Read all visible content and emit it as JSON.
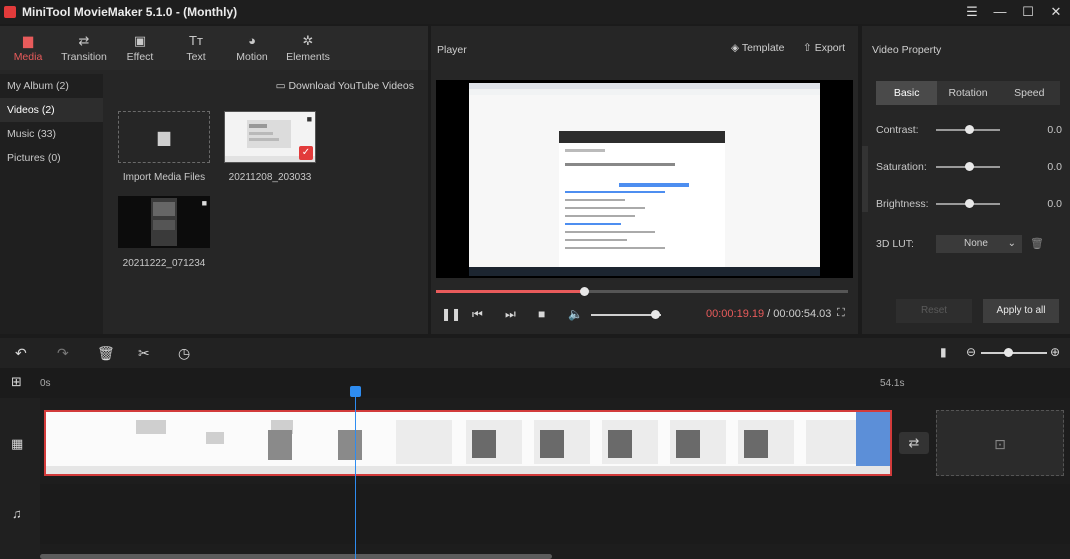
{
  "app": {
    "title": "MiniTool MovieMaker 5.1.0 - (Monthly)"
  },
  "window_controls": {
    "menu": "☰",
    "minimize": "—",
    "maximize": "☐",
    "close": "✕"
  },
  "toolbar": {
    "items": [
      {
        "label": "Media",
        "icon": "folder-icon",
        "glyph": "▆"
      },
      {
        "label": "Transition",
        "icon": "swap-icon",
        "glyph": "⇄"
      },
      {
        "label": "Effect",
        "icon": "effect-icon",
        "glyph": "▣"
      },
      {
        "label": "Text",
        "icon": "text-icon",
        "glyph": "Tт"
      },
      {
        "label": "Motion",
        "icon": "motion-icon",
        "glyph": "◕"
      },
      {
        "label": "Elements",
        "icon": "elements-icon",
        "glyph": "✲"
      }
    ]
  },
  "sidebar": {
    "items": [
      {
        "label": "My Album  (2)"
      },
      {
        "label": "Videos (2)"
      },
      {
        "label": "Music (33)"
      },
      {
        "label": "Pictures (0)"
      }
    ]
  },
  "media": {
    "download_label": "Download YouTube Videos",
    "import_label": "Import Media Files",
    "files": [
      {
        "name": "20211208_203033"
      },
      {
        "name": "20211222_071234"
      }
    ]
  },
  "player": {
    "label": "Player",
    "template_label": "Template",
    "export_label": "Export",
    "current_time": "00:00:19.19",
    "separator": " / ",
    "total_time": "00:00:54.03",
    "progress": 0.36,
    "volume": 0.92
  },
  "properties": {
    "title": "Video Property",
    "tabs": [
      {
        "label": "Basic"
      },
      {
        "label": "Rotation"
      },
      {
        "label": "Speed"
      }
    ],
    "rows": [
      {
        "label": "Contrast:",
        "value": "0.0"
      },
      {
        "label": "Saturation:",
        "value": "0.0"
      },
      {
        "label": "Brightness:",
        "value": "0.0"
      }
    ],
    "lut_label": "3D LUT:",
    "lut_value": "None",
    "reset_label": "Reset",
    "apply_label": "Apply to all"
  },
  "timeline": {
    "ruler_start": "0s",
    "ruler_end": "54.1s"
  },
  "colors": {
    "accent": "#e85b5b",
    "playhead": "#2e8cf0",
    "clip_border": "#d23b3b"
  }
}
